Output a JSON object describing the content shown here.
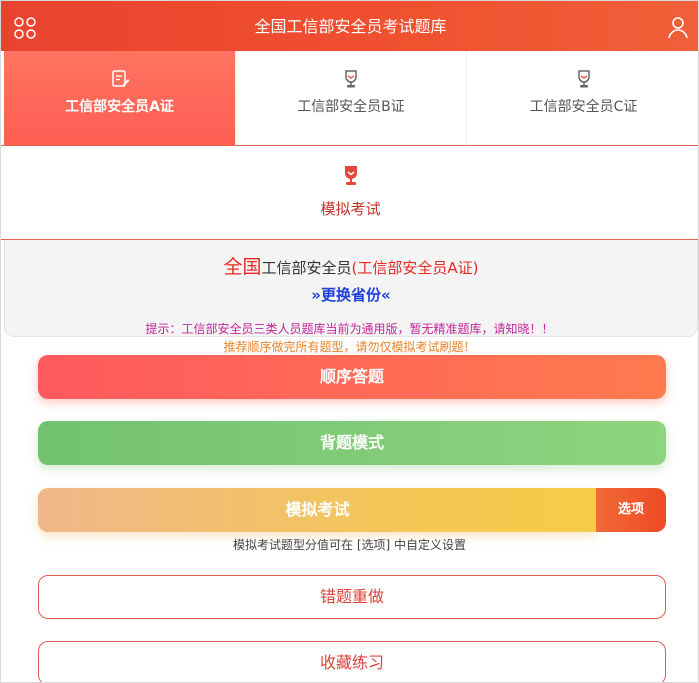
{
  "header": {
    "title": "全国工信部安全员考试题库",
    "menu_icon": "grid-menu-icon",
    "user_icon": "user-icon"
  },
  "tabs": [
    {
      "label": "工信部安全员A证",
      "icon": "edit-doc-icon",
      "active": true
    },
    {
      "label": "工信部安全员B证",
      "icon": "trophy-icon",
      "active": false
    },
    {
      "label": "工信部安全员C证",
      "icon": "trophy-icon",
      "active": false
    }
  ],
  "mock_tab": {
    "label": "模拟考试",
    "icon": "trophy-icon"
  },
  "info": {
    "region": "全国",
    "role": "工信部安全员",
    "cert": "(工信部安全员A证)",
    "change_province": "»更换省份«"
  },
  "tips": {
    "notice": "提示：工信部安全员三类人员题库当前为通用版，暂无精准题库，请知晓！！",
    "recommend": "推荐顺序做完所有题型，请勿仅模拟考试刷题！"
  },
  "buttons": {
    "order": "顺序答题",
    "recite": "背题模式",
    "mock": "模拟考试",
    "options": "选项",
    "mock_note": "模拟考试题型分值可在 [选项] 中自定义设置",
    "wrong": "错题重做",
    "favorite": "收藏练习"
  },
  "colors": {
    "header": "#ea4a30",
    "active_tab": "#ff6456",
    "order": "#ff6a55",
    "recite": "#7fcb76",
    "mock": "#f3c35a",
    "options": "#ee4a25",
    "link_blue": "#1f3fd8"
  }
}
